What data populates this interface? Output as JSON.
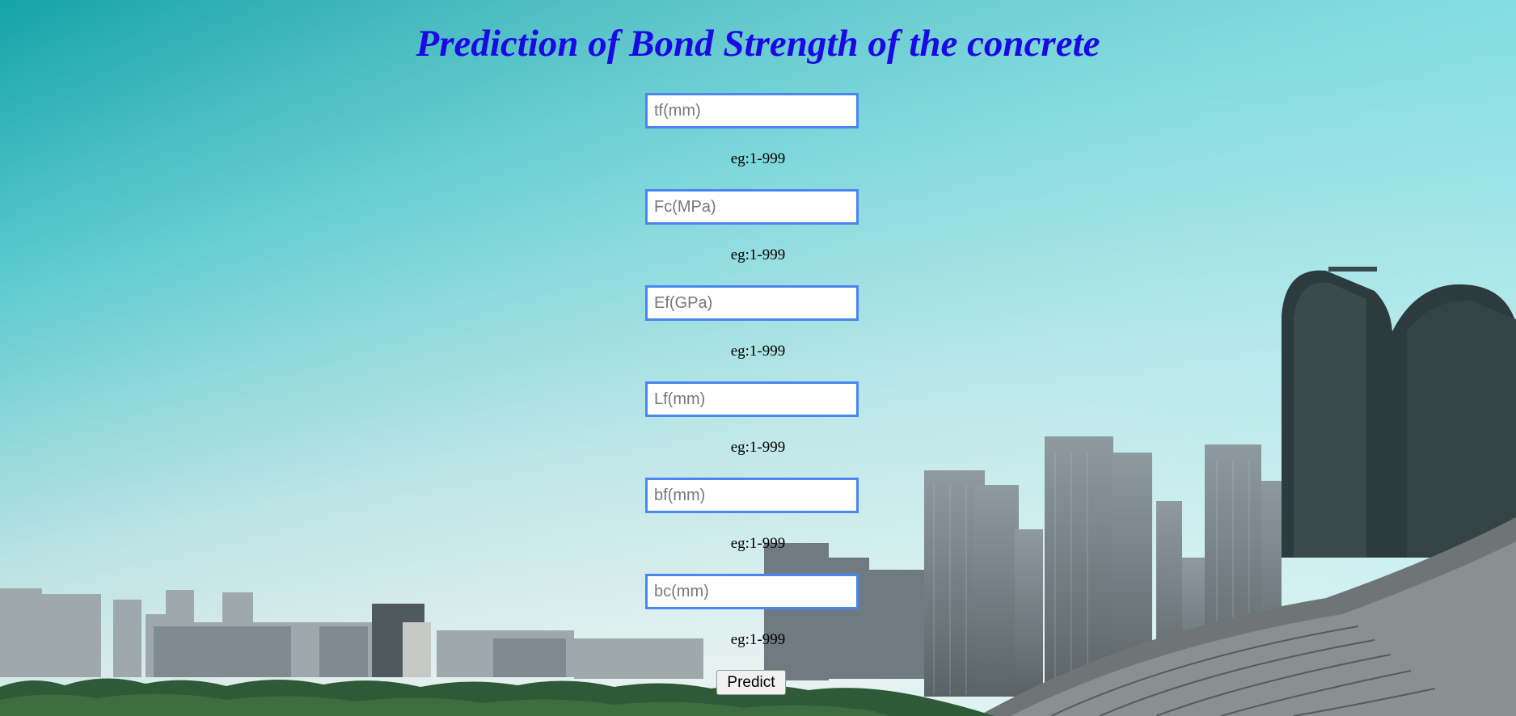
{
  "page": {
    "title": "Prediction of Bond Strength of the concrete"
  },
  "form": {
    "fields": [
      {
        "placeholder": "tf(mm)",
        "hint": "eg:1-999"
      },
      {
        "placeholder": "Fc(MPa)",
        "hint": "eg:1-999"
      },
      {
        "placeholder": "Ef(GPa)",
        "hint": "eg:1-999"
      },
      {
        "placeholder": "Lf(mm)",
        "hint": "eg:1-999"
      },
      {
        "placeholder": "bf(mm)",
        "hint": "eg:1-999"
      },
      {
        "placeholder": "bc(mm)",
        "hint": "eg:1-999"
      }
    ],
    "submit_label": "Predict"
  },
  "colors": {
    "title": "#1a08e6",
    "input_border": "#4a86f0",
    "sky_top": "#1fa9ad",
    "sky_bottom": "#eaf3f0"
  }
}
